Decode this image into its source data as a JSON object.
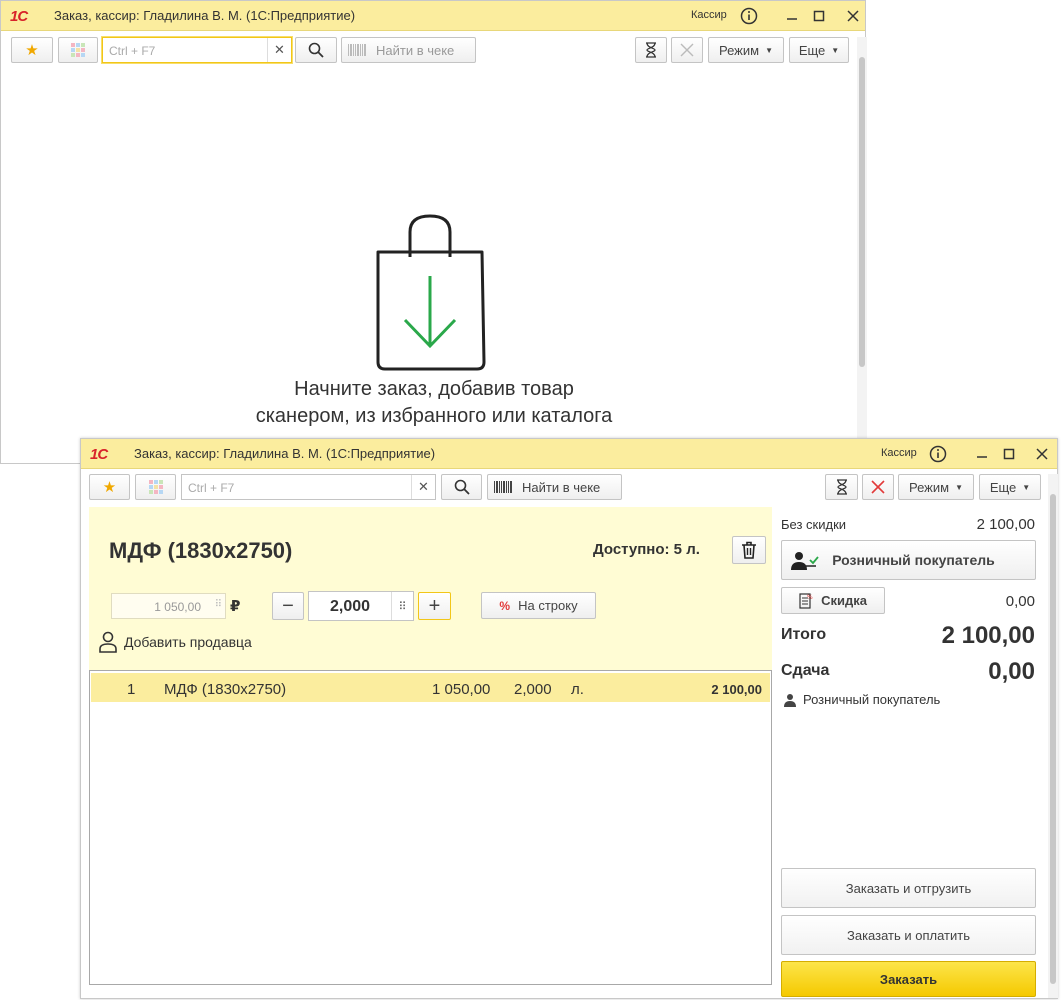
{
  "window1": {
    "title": "Заказ, кассир: Гладилина В. М.  (1С:Предприятие)",
    "role": "Кассир",
    "search_placeholder": "Ctrl + F7",
    "find_in_receipt": "Найти в чеке",
    "mode_label": "Режим",
    "more_label": "Еще",
    "empty_line1": "Начните заказ, добавив товар",
    "empty_line2": "сканером, из избранного или каталога"
  },
  "window2": {
    "title": "Заказ, кассир: Гладилина В. М.  (1С:Предприятие)",
    "role": "Кассир",
    "search_placeholder": "Ctrl + F7",
    "find_in_receipt": "Найти в чеке",
    "mode_label": "Режим",
    "more_label": "Еще",
    "product": {
      "name": "МДФ  (1830x2750)",
      "available": "Доступно: 5 л.",
      "price": "1 050,00",
      "currency": "₽",
      "quantity": "2,000",
      "per_line_label": "На строку",
      "add_seller_label": "Добавить продавца"
    },
    "lines": [
      {
        "n": "1",
        "name": "МДФ  (1830x2750)",
        "price": "1 050,00",
        "qty": "2,000",
        "unit": "л.",
        "sum": "2 100,00"
      }
    ],
    "summary": {
      "no_discount_label": "Без скидки",
      "no_discount_value": "2 100,00",
      "customer_button": "Розничный покупатель",
      "discount_button": "Скидка",
      "discount_value": "0,00",
      "total_label": "Итого",
      "total_value": "2 100,00",
      "change_label": "Сдача",
      "change_value": "0,00",
      "customer_name": "Розничный покупатель"
    },
    "actions": {
      "order_and_ship": "Заказать и отгрузить",
      "order_and_pay": "Заказать и оплатить",
      "order": "Заказать"
    }
  },
  "colors": {
    "titlebar": "#fbed9e",
    "accent": "#f5c900",
    "logo": "#d8232a",
    "bag_arrow": "#2aa84a"
  }
}
